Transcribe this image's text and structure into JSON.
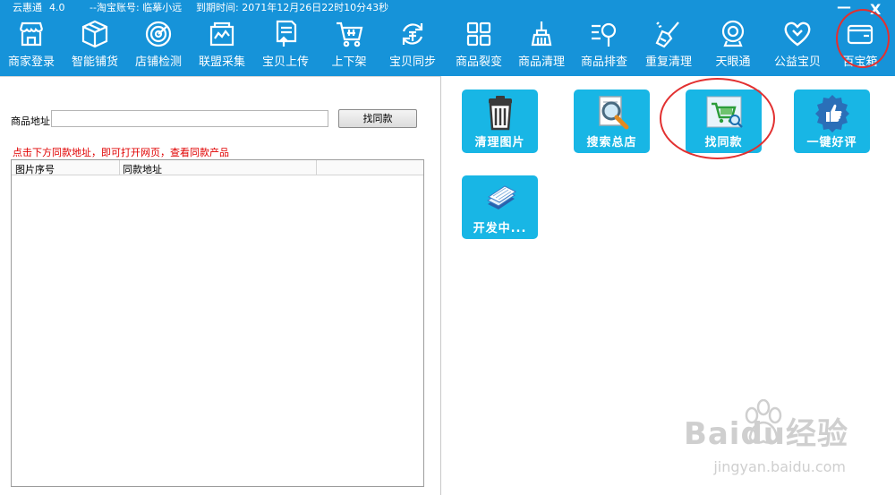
{
  "window": {
    "app_name": "云惠通",
    "version": "4.0",
    "account": "--淘宝账号: 临摹小远",
    "expiry": "到期时间: 2071年12月26日22时10分43秒",
    "minimize": "—",
    "close": "X"
  },
  "toolbar": [
    {
      "label": "商家登录",
      "icon": "storefront-icon"
    },
    {
      "label": "智能铺货",
      "icon": "box-icon"
    },
    {
      "label": "店铺检测",
      "icon": "radar-icon"
    },
    {
      "label": "联盟采集",
      "icon": "collect-icon"
    },
    {
      "label": "宝贝上传",
      "icon": "upload-doc-icon"
    },
    {
      "label": "上下架",
      "icon": "cart-icon"
    },
    {
      "label": "宝贝同步",
      "icon": "sync-icon"
    },
    {
      "label": "商品裂变",
      "icon": "grid-icon"
    },
    {
      "label": "商品清理",
      "icon": "broom-icon"
    },
    {
      "label": "商品排查",
      "icon": "search-list-icon"
    },
    {
      "label": "重复清理",
      "icon": "brush-icon"
    },
    {
      "label": "天眼通",
      "icon": "webcam-icon"
    },
    {
      "label": "公益宝贝",
      "icon": "heart-icon"
    },
    {
      "label": "百宝箱",
      "icon": "wallet-icon"
    }
  ],
  "left": {
    "address_label": "商品地址:",
    "address_value": "",
    "find_button": "找同款",
    "hint": "点击下方同款地址，即可打开网页，查看同款产品",
    "columns": [
      "图片序号",
      "同款地址"
    ],
    "rows": []
  },
  "tools": [
    {
      "label": "清理图片",
      "icon": "trash-icon"
    },
    {
      "label": "搜索总店",
      "icon": "magnifier-doc-icon"
    },
    {
      "label": "找同款",
      "icon": "cart-search-icon"
    },
    {
      "label": "一键好评",
      "icon": "thumbs-up-icon"
    },
    {
      "label": "开发中...",
      "icon": "papers-icon"
    }
  ],
  "watermark": {
    "brand": "Baidu经验",
    "url": "jingyan.baidu.com"
  },
  "colors": {
    "accent": "#1693d9",
    "tile": "#18b6e5",
    "hint": "#e00000",
    "highlight": "#e23030"
  }
}
